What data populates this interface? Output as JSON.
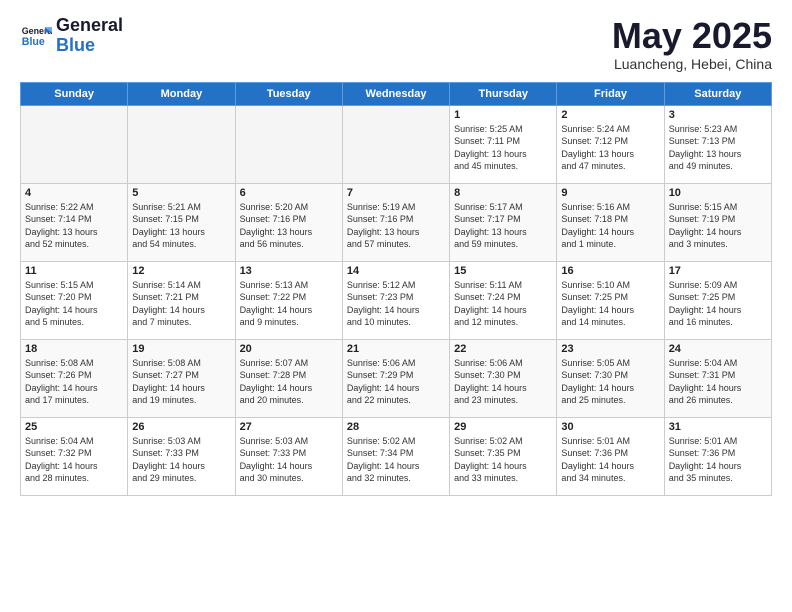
{
  "header": {
    "logo_line1": "General",
    "logo_line2": "Blue",
    "month": "May 2025",
    "location": "Luancheng, Hebei, China"
  },
  "days_of_week": [
    "Sunday",
    "Monday",
    "Tuesday",
    "Wednesday",
    "Thursday",
    "Friday",
    "Saturday"
  ],
  "weeks": [
    [
      {
        "day": "",
        "info": ""
      },
      {
        "day": "",
        "info": ""
      },
      {
        "day": "",
        "info": ""
      },
      {
        "day": "",
        "info": ""
      },
      {
        "day": "1",
        "info": "Sunrise: 5:25 AM\nSunset: 7:11 PM\nDaylight: 13 hours\nand 45 minutes."
      },
      {
        "day": "2",
        "info": "Sunrise: 5:24 AM\nSunset: 7:12 PM\nDaylight: 13 hours\nand 47 minutes."
      },
      {
        "day": "3",
        "info": "Sunrise: 5:23 AM\nSunset: 7:13 PM\nDaylight: 13 hours\nand 49 minutes."
      }
    ],
    [
      {
        "day": "4",
        "info": "Sunrise: 5:22 AM\nSunset: 7:14 PM\nDaylight: 13 hours\nand 52 minutes."
      },
      {
        "day": "5",
        "info": "Sunrise: 5:21 AM\nSunset: 7:15 PM\nDaylight: 13 hours\nand 54 minutes."
      },
      {
        "day": "6",
        "info": "Sunrise: 5:20 AM\nSunset: 7:16 PM\nDaylight: 13 hours\nand 56 minutes."
      },
      {
        "day": "7",
        "info": "Sunrise: 5:19 AM\nSunset: 7:16 PM\nDaylight: 13 hours\nand 57 minutes."
      },
      {
        "day": "8",
        "info": "Sunrise: 5:17 AM\nSunset: 7:17 PM\nDaylight: 13 hours\nand 59 minutes."
      },
      {
        "day": "9",
        "info": "Sunrise: 5:16 AM\nSunset: 7:18 PM\nDaylight: 14 hours\nand 1 minute."
      },
      {
        "day": "10",
        "info": "Sunrise: 5:15 AM\nSunset: 7:19 PM\nDaylight: 14 hours\nand 3 minutes."
      }
    ],
    [
      {
        "day": "11",
        "info": "Sunrise: 5:15 AM\nSunset: 7:20 PM\nDaylight: 14 hours\nand 5 minutes."
      },
      {
        "day": "12",
        "info": "Sunrise: 5:14 AM\nSunset: 7:21 PM\nDaylight: 14 hours\nand 7 minutes."
      },
      {
        "day": "13",
        "info": "Sunrise: 5:13 AM\nSunset: 7:22 PM\nDaylight: 14 hours\nand 9 minutes."
      },
      {
        "day": "14",
        "info": "Sunrise: 5:12 AM\nSunset: 7:23 PM\nDaylight: 14 hours\nand 10 minutes."
      },
      {
        "day": "15",
        "info": "Sunrise: 5:11 AM\nSunset: 7:24 PM\nDaylight: 14 hours\nand 12 minutes."
      },
      {
        "day": "16",
        "info": "Sunrise: 5:10 AM\nSunset: 7:25 PM\nDaylight: 14 hours\nand 14 minutes."
      },
      {
        "day": "17",
        "info": "Sunrise: 5:09 AM\nSunset: 7:25 PM\nDaylight: 14 hours\nand 16 minutes."
      }
    ],
    [
      {
        "day": "18",
        "info": "Sunrise: 5:08 AM\nSunset: 7:26 PM\nDaylight: 14 hours\nand 17 minutes."
      },
      {
        "day": "19",
        "info": "Sunrise: 5:08 AM\nSunset: 7:27 PM\nDaylight: 14 hours\nand 19 minutes."
      },
      {
        "day": "20",
        "info": "Sunrise: 5:07 AM\nSunset: 7:28 PM\nDaylight: 14 hours\nand 20 minutes."
      },
      {
        "day": "21",
        "info": "Sunrise: 5:06 AM\nSunset: 7:29 PM\nDaylight: 14 hours\nand 22 minutes."
      },
      {
        "day": "22",
        "info": "Sunrise: 5:06 AM\nSunset: 7:30 PM\nDaylight: 14 hours\nand 23 minutes."
      },
      {
        "day": "23",
        "info": "Sunrise: 5:05 AM\nSunset: 7:30 PM\nDaylight: 14 hours\nand 25 minutes."
      },
      {
        "day": "24",
        "info": "Sunrise: 5:04 AM\nSunset: 7:31 PM\nDaylight: 14 hours\nand 26 minutes."
      }
    ],
    [
      {
        "day": "25",
        "info": "Sunrise: 5:04 AM\nSunset: 7:32 PM\nDaylight: 14 hours\nand 28 minutes."
      },
      {
        "day": "26",
        "info": "Sunrise: 5:03 AM\nSunset: 7:33 PM\nDaylight: 14 hours\nand 29 minutes."
      },
      {
        "day": "27",
        "info": "Sunrise: 5:03 AM\nSunset: 7:33 PM\nDaylight: 14 hours\nand 30 minutes."
      },
      {
        "day": "28",
        "info": "Sunrise: 5:02 AM\nSunset: 7:34 PM\nDaylight: 14 hours\nand 32 minutes."
      },
      {
        "day": "29",
        "info": "Sunrise: 5:02 AM\nSunset: 7:35 PM\nDaylight: 14 hours\nand 33 minutes."
      },
      {
        "day": "30",
        "info": "Sunrise: 5:01 AM\nSunset: 7:36 PM\nDaylight: 14 hours\nand 34 minutes."
      },
      {
        "day": "31",
        "info": "Sunrise: 5:01 AM\nSunset: 7:36 PM\nDaylight: 14 hours\nand 35 minutes."
      }
    ]
  ]
}
